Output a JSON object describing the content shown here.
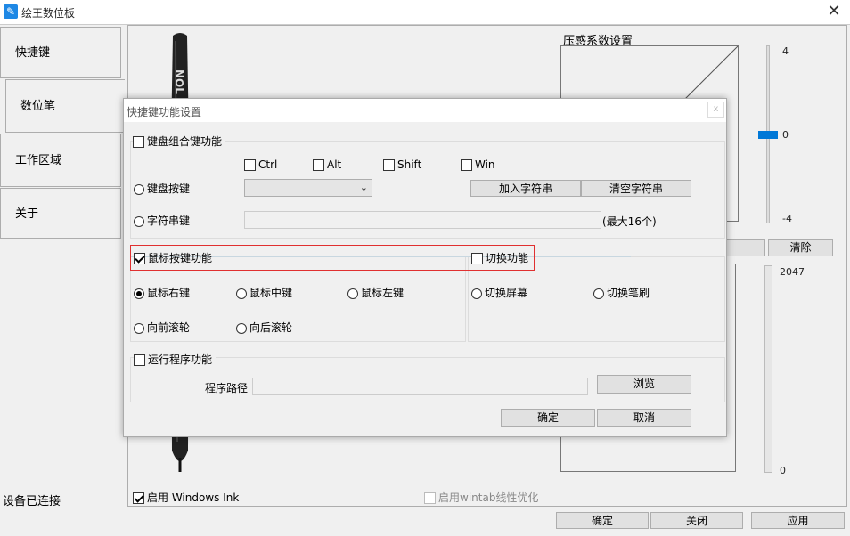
{
  "window": {
    "title": "绘王数位板",
    "close": "✕"
  },
  "nav": {
    "items": [
      {
        "label": "快捷键"
      },
      {
        "label": "数位笔"
      },
      {
        "label": "工作区域"
      },
      {
        "label": "关于"
      }
    ]
  },
  "status": "设备已连接",
  "pen": {
    "brand": "NOL"
  },
  "pressure": {
    "title": "压感系数设置",
    "scale_top": "4",
    "scale_mid": "0",
    "scale_bottom": "-4",
    "level": 0,
    "clear_label": "清除",
    "scale2_top": "2047",
    "scale2_bottom": "0"
  },
  "bottom": {
    "windows_ink_label": "启用 Windows Ink",
    "windows_ink_checked": true,
    "wintab_label": "启用wintab线性优化",
    "ok": "确定",
    "close": "关闭",
    "apply": "应用"
  },
  "dialog": {
    "title": "快捷键功能设置",
    "close": "x",
    "keyboard_combo_label": "键盘组合键功能",
    "modifiers": [
      "Ctrl",
      "Alt",
      "Shift",
      "Win"
    ],
    "key_label": "键盘按键",
    "key_value": "",
    "add_string": "加入字符串",
    "clear_string": "清空字符串",
    "string_label": "字符串键",
    "string_value": "",
    "max_hint": "(最大16个)",
    "mouse_label": "鼠标按键功能",
    "mouse_checked": true,
    "switch_label": "切换功能",
    "mouse_options": [
      "鼠标右键",
      "鼠标中键",
      "鼠标左键",
      "向前滚轮",
      "向后滚轮"
    ],
    "mouse_selected": "鼠标右键",
    "switch_options": [
      "切换屏幕",
      "切换笔刷"
    ],
    "run_label": "运行程序功能",
    "path_label": "程序路径",
    "path_value": "",
    "browse": "浏览",
    "ok": "确定",
    "cancel": "取消"
  },
  "colors": {
    "accent": "#0078d7",
    "highlight_border": "#e03030"
  }
}
